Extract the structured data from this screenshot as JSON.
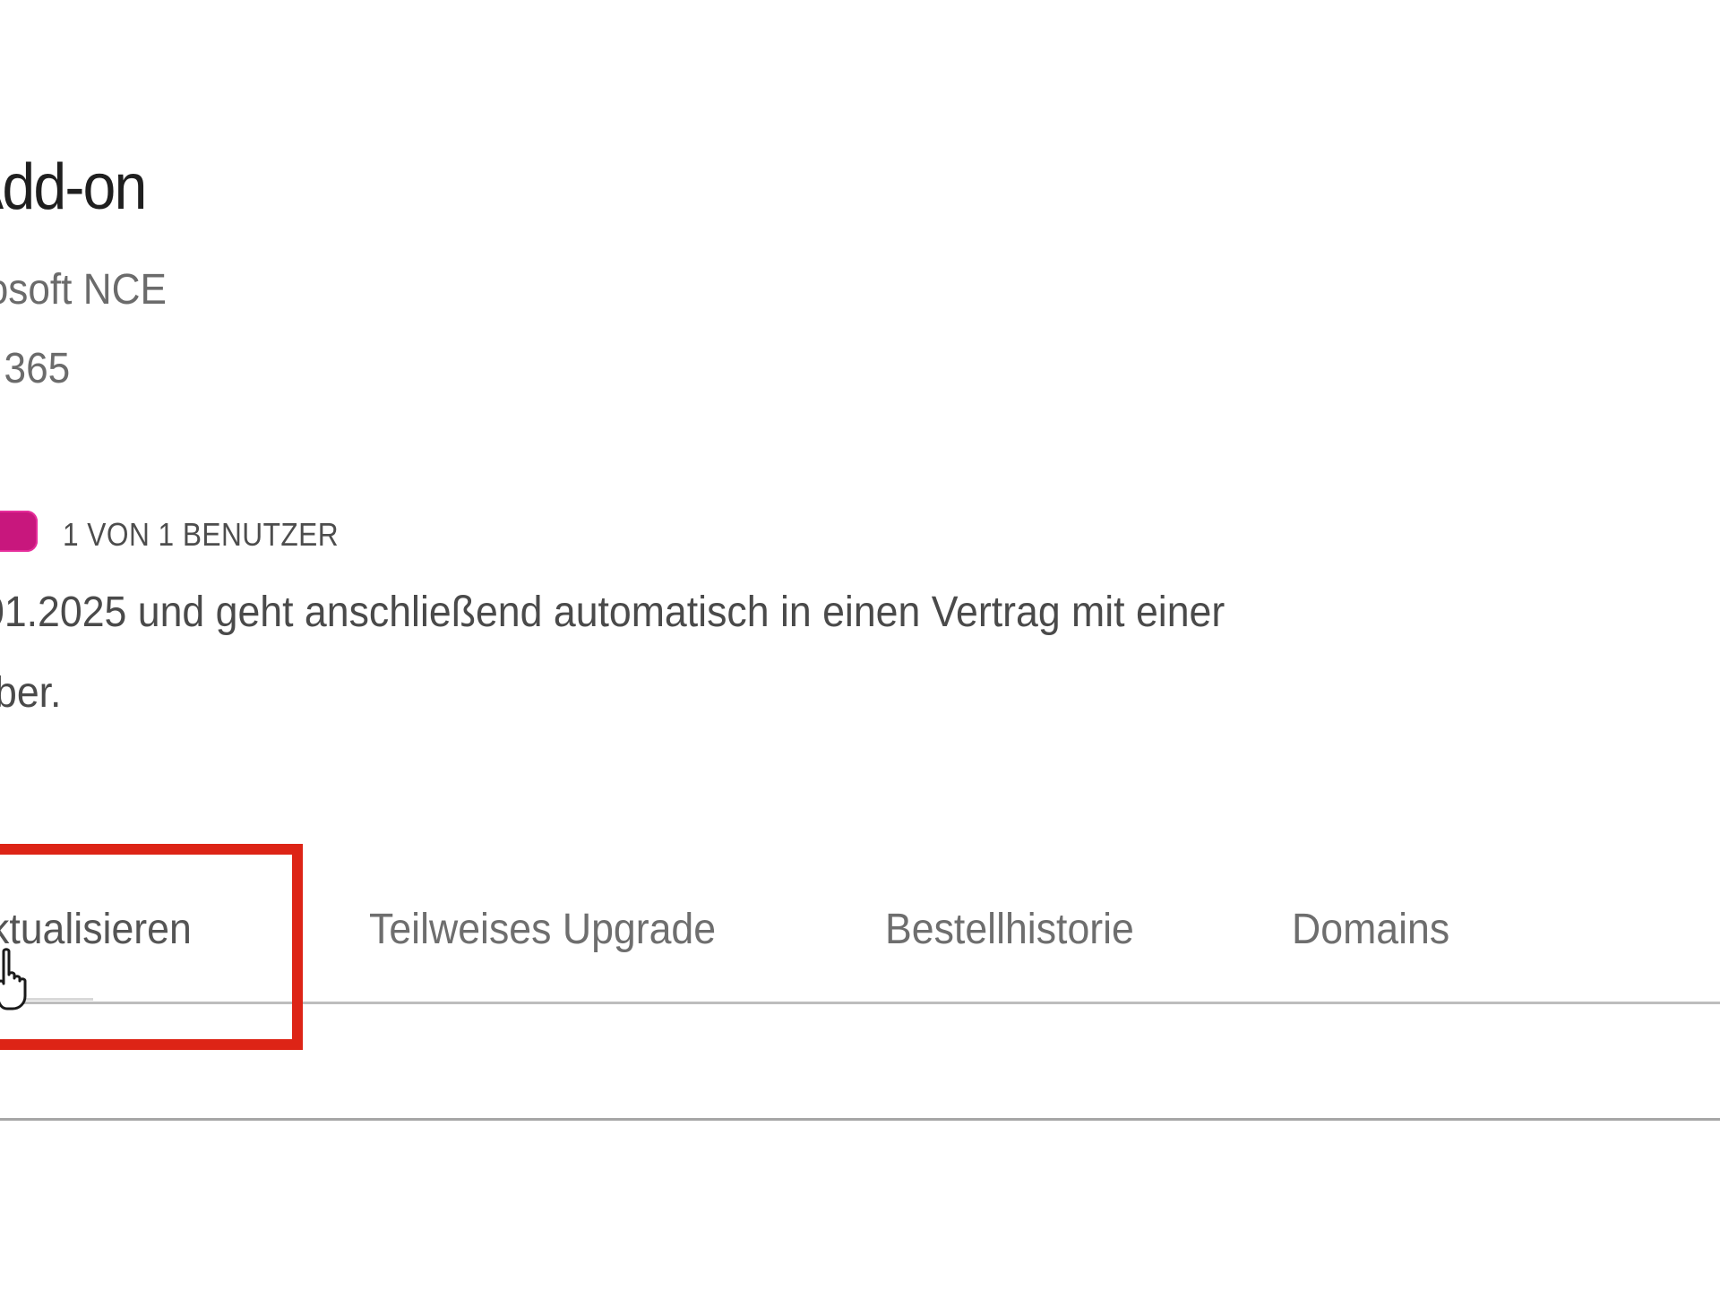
{
  "product": {
    "title": "Add-on",
    "vendor": "rosoft NCE",
    "family": ": 365"
  },
  "usage": {
    "label": "1 VON 1 BENUTZER",
    "fill_fraction": 1.0,
    "color": "#c8177d"
  },
  "description": {
    "line1": "01.2025 und geht anschließend automatisch in einen Vertrag mit einer",
    "line2": "ber."
  },
  "tabs": [
    {
      "label": "ktualisieren",
      "active": true
    },
    {
      "label": "Teilweises Upgrade",
      "active": false
    },
    {
      "label": "Bestellhistorie",
      "active": false
    },
    {
      "label": "Domains",
      "active": false
    }
  ],
  "annotation": {
    "highlight_color": "#dd2416"
  },
  "cursor": {
    "icon": "hand-pointer-icon"
  }
}
